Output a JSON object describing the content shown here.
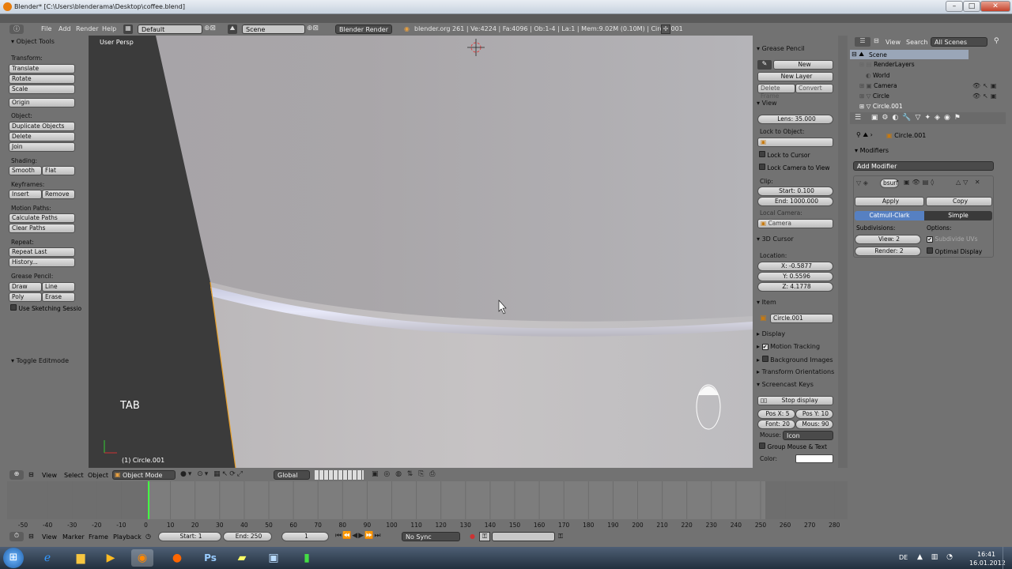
{
  "window": {
    "title": "Blender* [C:\\Users\\blenderama\\Desktop\\coffee.blend]",
    "min": "–",
    "max": "□",
    "close": "✕"
  },
  "infobar": {
    "menus": [
      "File",
      "Add",
      "Render",
      "Help"
    ],
    "layout": "Default",
    "scene": "Scene",
    "engine": "Blender Render",
    "stats": "blender.org 261 | Ve:4224 | Fa:4096 | Ob:1-4 | La:1 | Mem:9.02M (0.10M) | Circle.001"
  },
  "tools": {
    "header": "Object Tools",
    "transform_label": "Transform:",
    "translate": "Translate",
    "rotate": "Rotate",
    "scale": "Scale",
    "origin": "Origin",
    "object_label": "Object:",
    "duplicate": "Duplicate Objects",
    "delete": "Delete",
    "join": "Join",
    "shading_label": "Shading:",
    "smooth": "Smooth",
    "flat": "Flat",
    "keyframes_label": "Keyframes:",
    "insert": "Insert",
    "remove": "Remove",
    "motion_label": "Motion Paths:",
    "calc_paths": "Calculate Paths",
    "clear_paths": "Clear Paths",
    "repeat_label": "Repeat:",
    "repeat_last": "Repeat Last",
    "history": "History...",
    "gp_label": "Grease Pencil:",
    "draw": "Draw",
    "line": "Line",
    "poly": "Poly",
    "erase": "Erase",
    "sketching": "Use Sketching Sessio",
    "toggle_edit": "Toggle Editmode"
  },
  "viewport": {
    "label": "User Persp",
    "object": "(1) Circle.001",
    "key": "TAB"
  },
  "npanel": {
    "grease_pencil": "Grease Pencil",
    "new": "New",
    "new_layer": "New Layer",
    "delete_frame": "Delete Frame",
    "convert": "Convert",
    "view": "View",
    "lens": "Lens: 35.000",
    "lock_to_object": "Lock to Object:",
    "lock_to_cursor": "Lock to Cursor",
    "lock_camera": "Lock Camera to View",
    "clip": "Clip:",
    "clip_start": "Start: 0.100",
    "clip_end": "End: 1000.000",
    "local_camera": "Local Camera:",
    "camera": "Camera",
    "cursor": "3D Cursor",
    "location": "Location:",
    "cx": "X: -0.5877",
    "cy": "Y: 0.5596",
    "cz": "Z: 4.1778",
    "item": "Item",
    "item_name": "Circle.001",
    "display": "Display",
    "motion_tracking": "Motion Tracking",
    "background_images": "Background Images",
    "transform_orientations": "Transform Orientations",
    "screencast": "Screencast Keys",
    "stop_display": "Stop display",
    "pos_x": "Pos X: 5",
    "pos_y": "Pos Y: 10",
    "font": "Font: 20",
    "mouse_size": "Mous: 90",
    "mouse_label": "Mouse:",
    "mouse_mode": "Icon",
    "group_mouse": "Group Mouse & Text",
    "color": "Color:"
  },
  "outliner": {
    "view": "View",
    "search": "Search",
    "filter": "All Scenes",
    "items": [
      "Scene",
      "RenderLayers",
      "World",
      "Camera",
      "Circle",
      "Circle.001"
    ]
  },
  "properties": {
    "object_name": "Circle.001",
    "modifiers": "Modifiers",
    "add_modifier": "Add Modifier",
    "mod_name": "bsurf",
    "apply": "Apply",
    "copy": "Copy",
    "catmull": "Catmull-Clark",
    "simple": "Simple",
    "subdivisions": "Subdivisions:",
    "options": "Options:",
    "view_level": "View: 2",
    "render_level": "Render: 2",
    "subdivide_uvs": "Subdivide UVs",
    "optimal_display": "Optimal Display"
  },
  "view3d_header": {
    "view": "View",
    "select": "Select",
    "object": "Object",
    "mode": "Object Mode",
    "orientation": "Global"
  },
  "timeline": {
    "ticks": [
      "-50",
      "-40",
      "-30",
      "-20",
      "-10",
      "0",
      "10",
      "20",
      "30",
      "40",
      "50",
      "60",
      "70",
      "80",
      "90",
      "100",
      "110",
      "120",
      "130",
      "140",
      "150",
      "160",
      "170",
      "180",
      "190",
      "200",
      "210",
      "220",
      "230",
      "240",
      "250",
      "260",
      "270",
      "280"
    ],
    "view": "View",
    "marker": "Marker",
    "frame": "Frame",
    "playback": "Playback",
    "start": "Start: 1",
    "end": "End: 250",
    "current": "1",
    "sync": "No Sync"
  },
  "taskbar": {
    "lang": "DE",
    "time": "16:41",
    "date": "16.01.2012"
  },
  "colors": {
    "accent": "#5680c2",
    "selected_row": "#9aa6b8"
  }
}
